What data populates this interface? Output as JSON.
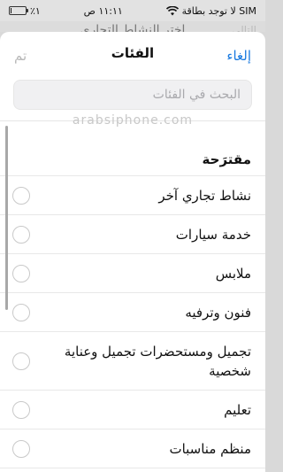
{
  "status_bar": {
    "carrier": "لا توجد بطاقة SIM",
    "time": "١١:١١ ص",
    "battery_percent": "٪١",
    "battery_level": 0.01
  },
  "behind": {
    "title": "اختر النشاط التجاري",
    "right_action": "التالي"
  },
  "nav": {
    "cancel": "إلغاء",
    "title": "الفئات",
    "done": "تم"
  },
  "search": {
    "placeholder": "البحث في الفئات"
  },
  "watermark": "arabsiphone.com",
  "section": {
    "title": "مقترَحة"
  },
  "items": [
    {
      "label": "نشاط تجاري آخر"
    },
    {
      "label": "خدمة سيارات"
    },
    {
      "label": "ملابس"
    },
    {
      "label": "فنون وترفيه"
    },
    {
      "label": "تجميل ومستحضرات تجميل وعناية شخصية"
    },
    {
      "label": "تعليم"
    },
    {
      "label": "منظم مناسبات"
    }
  ]
}
